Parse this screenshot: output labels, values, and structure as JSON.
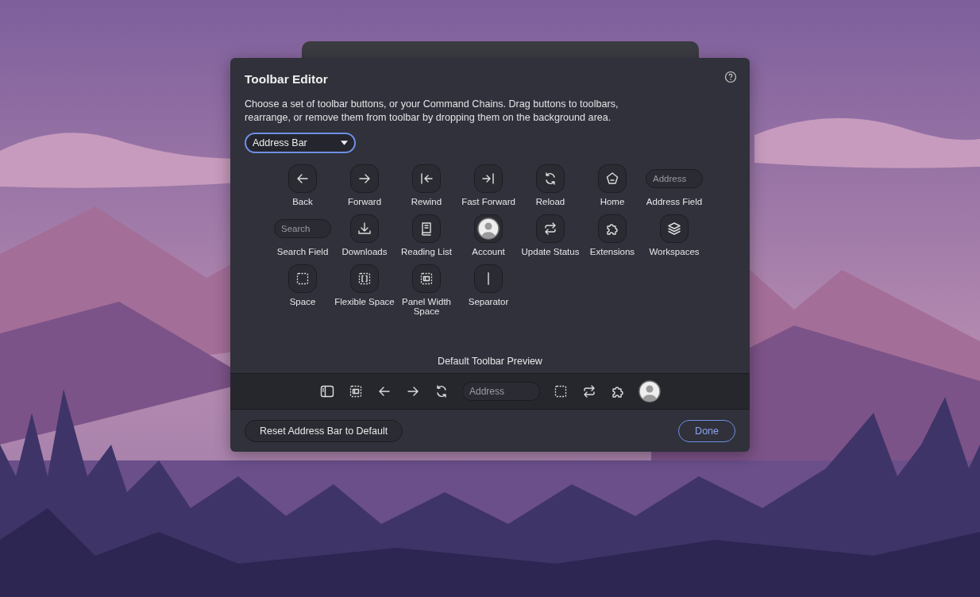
{
  "dialog": {
    "title": "Toolbar Editor",
    "description": "Choose a set of toolbar buttons, or your Command Chains. Drag buttons to toolbars, rearrange, or remove them from toolbar by dropping them on the background area.",
    "toolbar_select": {
      "value": "Address Bar"
    },
    "items": [
      {
        "kind": "button",
        "label": "Back"
      },
      {
        "kind": "button",
        "label": "Forward"
      },
      {
        "kind": "button",
        "label": "Rewind"
      },
      {
        "kind": "button",
        "label": "Fast Forward"
      },
      {
        "kind": "button",
        "label": "Reload"
      },
      {
        "kind": "button",
        "label": "Home"
      },
      {
        "kind": "field",
        "label": "Address Field",
        "placeholder": "Address"
      },
      {
        "kind": "field",
        "label": "Search Field",
        "placeholder": "Search"
      },
      {
        "kind": "button",
        "label": "Downloads"
      },
      {
        "kind": "button",
        "label": "Reading List"
      },
      {
        "kind": "avatar",
        "label": "Account"
      },
      {
        "kind": "button",
        "label": "Update Status"
      },
      {
        "kind": "button",
        "label": "Extensions"
      },
      {
        "kind": "button",
        "label": "Workspaces"
      },
      {
        "kind": "button",
        "label": "Space"
      },
      {
        "kind": "button",
        "label": "Flexible Space"
      },
      {
        "kind": "button",
        "label": "Panel Width Space"
      },
      {
        "kind": "button",
        "label": "Separator"
      }
    ],
    "preview": {
      "title": "Default Toolbar Preview",
      "items": [
        {
          "kind": "button"
        },
        {
          "kind": "button"
        },
        {
          "kind": "button"
        },
        {
          "kind": "button"
        },
        {
          "kind": "button"
        },
        {
          "kind": "field",
          "placeholder": "Address"
        },
        {
          "kind": "button"
        },
        {
          "kind": "button"
        },
        {
          "kind": "button"
        },
        {
          "kind": "avatar"
        }
      ]
    },
    "reset_button": "Reset Address Bar to Default",
    "done_button": "Done"
  }
}
